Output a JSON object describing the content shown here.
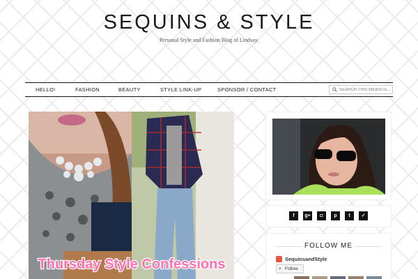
{
  "header": {
    "title": "SEQUINS & STYLE",
    "tagline": "Personal Style and Fashion Blog of Lindsay."
  },
  "nav": {
    "items": [
      {
        "label": "HELLO!"
      },
      {
        "label": "FASHION"
      },
      {
        "label": "BEAUTY"
      },
      {
        "label": "STYLE LINK-UP"
      },
      {
        "label": "SPONSOR / CONTACT"
      }
    ],
    "search_placeholder": "SEARCH THIS WEBSITE..."
  },
  "post": {
    "banner_text": "Thursday Style Confessions"
  },
  "sidebar": {
    "social_icons": [
      {
        "name": "facebook-icon",
        "glyph": "f"
      },
      {
        "name": "google-plus-icon",
        "glyph": "g+"
      },
      {
        "name": "instagram-icon",
        "glyph": "◘"
      },
      {
        "name": "pinterest-icon",
        "glyph": "p"
      },
      {
        "name": "tumblr-icon",
        "glyph": "t"
      },
      {
        "name": "twitter-icon",
        "glyph": "✓"
      }
    ],
    "follow_title": "FOLLOW ME",
    "blog_name": "SequinsandStyle",
    "follow_button_label": "Follow",
    "follow_button_icon": "+"
  },
  "colors": {
    "banner_text": "#ff6fb1",
    "blogger": "#e8553d"
  }
}
